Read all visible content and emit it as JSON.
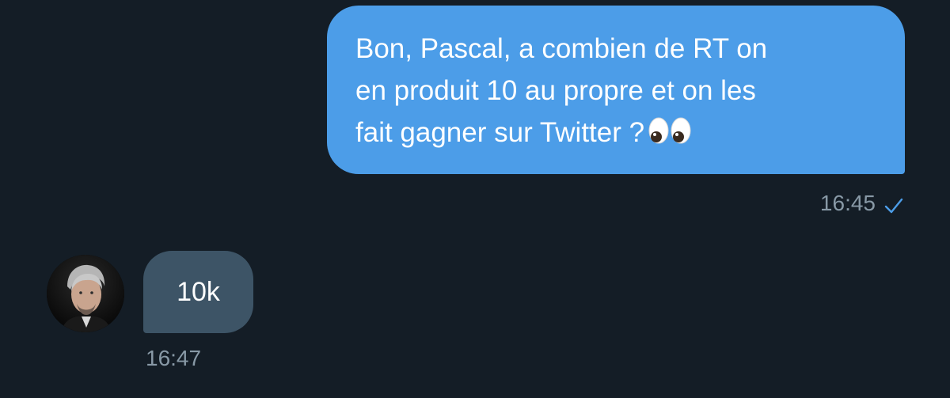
{
  "colors": {
    "background": "#141d26",
    "outgoing_bubble": "#4c9de8",
    "incoming_bubble": "#3d5466",
    "timestamp": "#8899a6",
    "read_check": "#4c9de8"
  },
  "conversation": {
    "messages": [
      {
        "direction": "outgoing",
        "lines": [
          "Bon, Pascal, a combien de RT on",
          "en produit 10 au propre et on les",
          "fait gagner sur Twitter ?"
        ],
        "emoji": "eyes-emoji",
        "time": "16:45",
        "status_icon": "read-check-icon"
      },
      {
        "direction": "incoming",
        "avatar_icon": "sender-portrait",
        "text": "10k",
        "time": "16:47"
      }
    ]
  }
}
